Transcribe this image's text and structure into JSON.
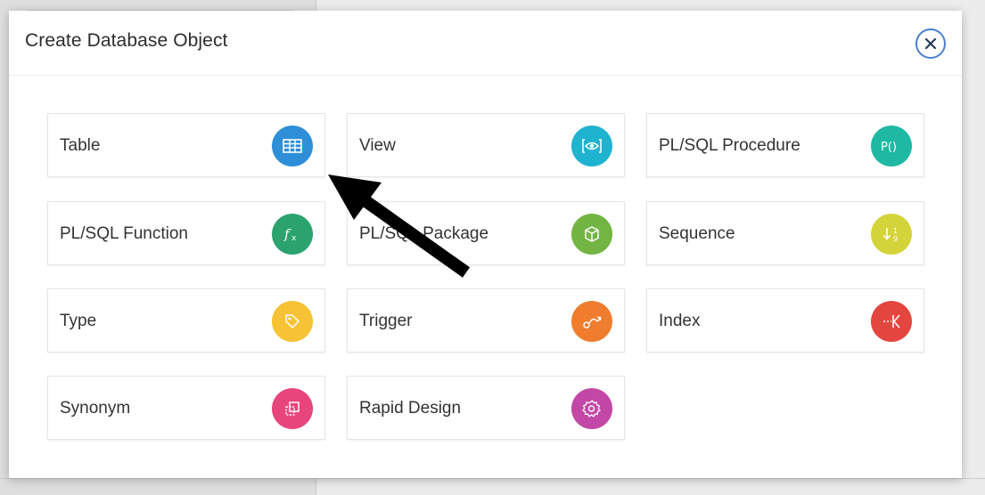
{
  "dialog": {
    "title": "Create Database Object",
    "close_icon": "close-icon"
  },
  "tiles": [
    {
      "label": "Table",
      "icon": "table-icon",
      "color": "#2e8fd8"
    },
    {
      "label": "View",
      "icon": "view-icon",
      "color": "#1fb3cf"
    },
    {
      "label": "PL/SQL Procedure",
      "icon": "procedure-icon",
      "color": "#1fb9a3"
    },
    {
      "label": "PL/SQL Function",
      "icon": "function-icon",
      "color": "#2aa36e"
    },
    {
      "label": "PL/SQL Package",
      "icon": "package-icon",
      "color": "#72b543"
    },
    {
      "label": "Sequence",
      "icon": "sequence-icon",
      "color": "#d3d43a"
    },
    {
      "label": "Type",
      "icon": "tag-icon",
      "color": "#f7c233"
    },
    {
      "label": "Trigger",
      "icon": "trigger-icon",
      "color": "#ef7d2d"
    },
    {
      "label": "Index",
      "icon": "index-icon",
      "color": "#e2463f"
    },
    {
      "label": "Synonym",
      "icon": "synonym-icon",
      "color": "#e8457c"
    },
    {
      "label": "Rapid Design",
      "icon": "gear-icon",
      "color": "#c347a6"
    }
  ],
  "annotation": {
    "arrow_icon": "pointer-arrow-icon",
    "color": "#000000"
  },
  "colors": {
    "close_border": "#4a7fd0",
    "title_text": "#2d2d2d"
  }
}
